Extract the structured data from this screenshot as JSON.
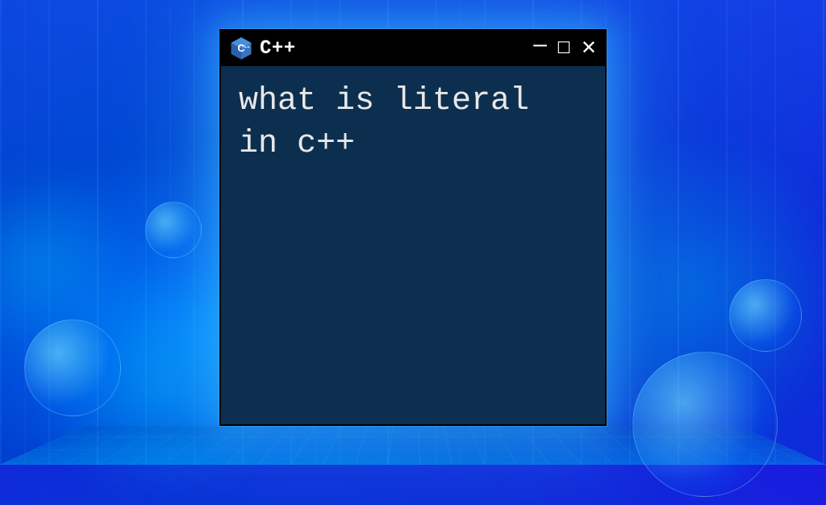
{
  "window": {
    "title": "C++",
    "icon_name": "cpp-icon",
    "content_text": "what is literal in c++"
  },
  "controls": {
    "minimize": "–",
    "maximize": "☐",
    "close": "✕"
  },
  "colors": {
    "window_bg": "#0d2f4f",
    "titlebar_bg": "#000000",
    "text": "#e8e8e8",
    "glow": "#32b4ff"
  }
}
